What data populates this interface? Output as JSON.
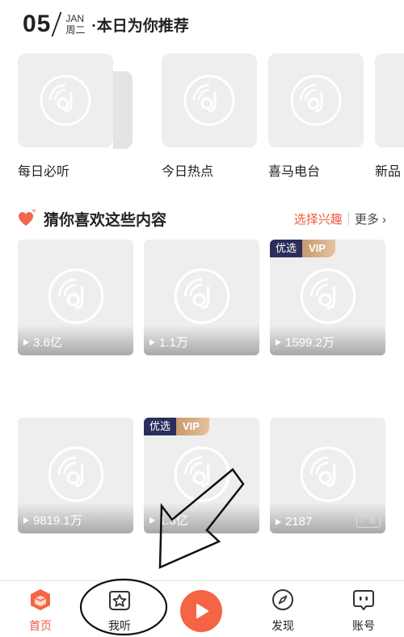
{
  "header": {
    "day": "05",
    "month": "JAN",
    "weekday": "周二",
    "title": "·本日为你推荐"
  },
  "top_categories": [
    {
      "label": "每日必听"
    },
    {
      "label": "今日热点"
    },
    {
      "label": "喜马电台"
    },
    {
      "label": "新品"
    }
  ],
  "section": {
    "title": "猜你喜欢这些内容",
    "pick_interest": "选择兴趣",
    "more": "更多",
    "more_chevron": "›"
  },
  "cards": [
    {
      "plays": "3.6亿"
    },
    {
      "plays": "1.1万"
    },
    {
      "plays": "1599.2万",
      "badge_left": "优选",
      "badge_right": "VIP"
    },
    {
      "plays": "9819.1万"
    },
    {
      "plays": "1.3亿",
      "badge_left": "优选",
      "badge_right": "VIP"
    },
    {
      "plays": "2187",
      "ad": "广告"
    }
  ],
  "nav": {
    "home": "首页",
    "listen": "我听",
    "discover": "发现",
    "account": "账号"
  },
  "colors": {
    "accent": "#f05a3c",
    "play_button": "#f36545",
    "vip_dark": "#2b2e5a",
    "vip_gold": "#c89a6e",
    "tile": "#eeeeee"
  },
  "icons": {
    "placeholder": "vinyl-disc-icon",
    "home": "home-icon",
    "listen": "star-icon",
    "discover": "compass-icon",
    "account": "face-icon",
    "play": "play-icon"
  }
}
